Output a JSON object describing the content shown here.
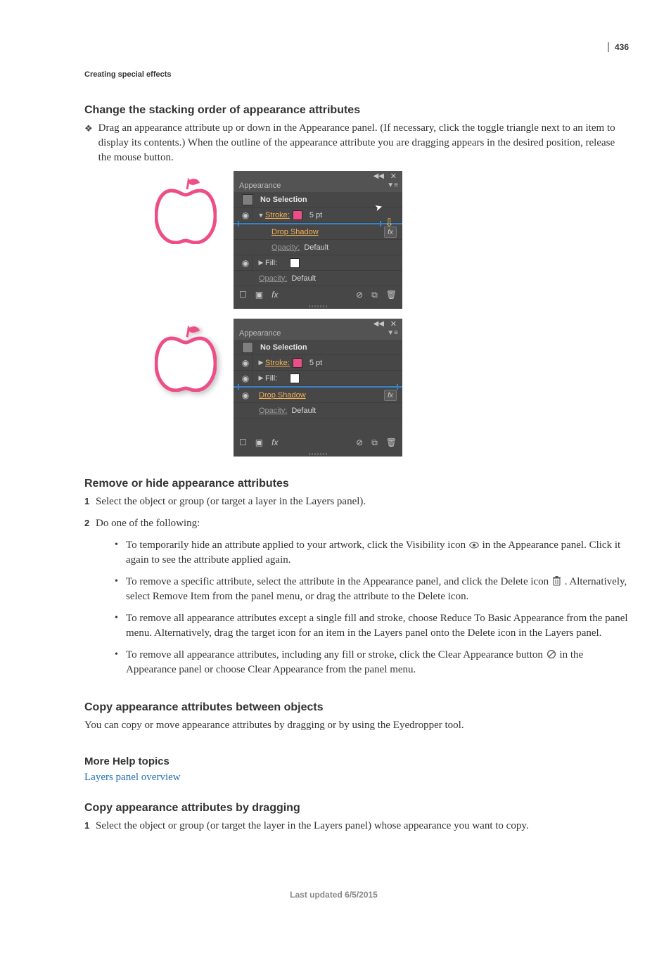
{
  "page": {
    "number": "436",
    "running_header": "Creating special effects",
    "last_updated": "Last updated 6/5/2015"
  },
  "sections": {
    "s1": {
      "title": "Change the stacking order of appearance attributes",
      "bullet": "Drag an appearance attribute up or down in the Appearance panel. (If necessary, click the toggle triangle next to an item to display its contents.) When the outline of the appearance attribute you are dragging appears in the desired position, release the mouse button."
    },
    "s2": {
      "title": "Remove or hide appearance attributes",
      "step1": "Select the object or group (or target a layer in the Layers panel).",
      "step2": "Do one of the following:",
      "b1a": "To temporarily hide an attribute applied to your artwork, click the Visibility icon ",
      "b1b": " in the Appearance panel. Click it again to see the attribute applied again.",
      "b2a": "To remove a specific attribute, select the attribute in the Appearance panel, and click the Delete icon ",
      "b2b": " . Alternatively, select Remove Item from the panel menu, or drag the attribute to the Delete icon.",
      "b3": "To remove all appearance attributes except a single fill and stroke, choose Reduce To Basic Appearance from the panel menu. Alternatively, drag the target icon for an item in the Layers panel onto the Delete icon in the Layers panel.",
      "b4a": "To remove all appearance attributes, including any fill or stroke, click the Clear Appearance button ",
      "b4b": " in the Appearance panel or choose Clear Appearance from the panel menu."
    },
    "s3": {
      "title": "Copy appearance attributes between objects",
      "body": "You can copy or move appearance attributes by dragging or by using the Eyedropper tool."
    },
    "more_help": {
      "title": "More Help topics",
      "link": "Layers panel overview"
    },
    "s4": {
      "title": "Copy appearance attributes by dragging",
      "step1": "Select the object or group (or target the layer in the Layers panel) whose appearance you want to copy."
    }
  },
  "panel": {
    "tab": "Appearance",
    "header": "No Selection",
    "stroke_label": "Stroke:",
    "stroke_value": "5 pt",
    "drop_shadow": "Drop Shadow",
    "opacity_label": "Opacity:",
    "opacity_value": "Default",
    "fill_label": "Fill:",
    "fx": "fx"
  }
}
